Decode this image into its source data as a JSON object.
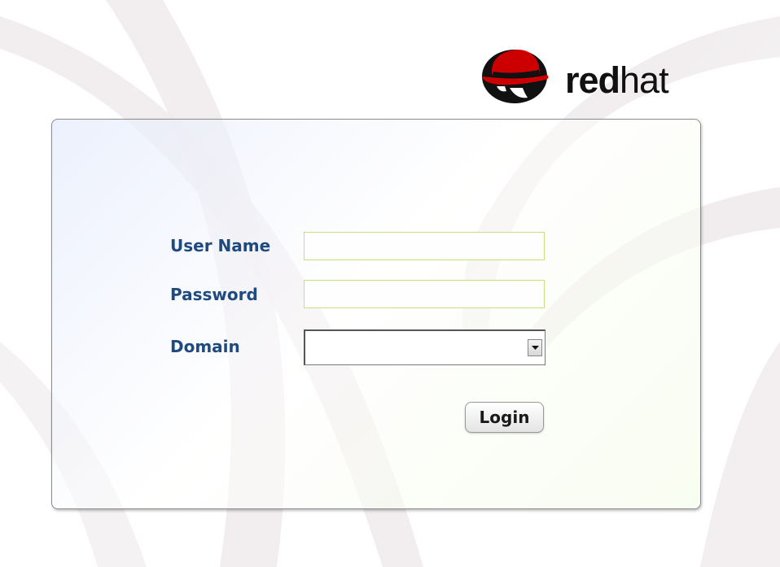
{
  "brand": {
    "logo_bold": "red",
    "logo_light": "hat",
    "logo_mark": "shadowman-logo-icon",
    "color_red": "#cc0000"
  },
  "form": {
    "user_name_label": "User Name",
    "user_name_value": "",
    "password_label": "Password",
    "password_value": "",
    "domain_label": "Domain",
    "domain_selected": "",
    "login_label": "Login"
  },
  "colors": {
    "label_text": "#1e4a80",
    "field_border": "#c8e07a"
  }
}
